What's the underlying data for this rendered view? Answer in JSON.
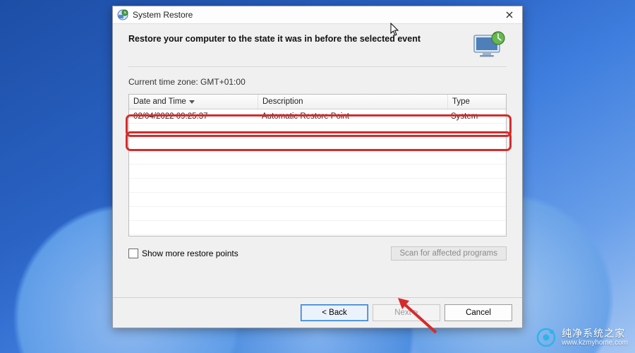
{
  "window": {
    "title": "System Restore",
    "heading": "Restore your computer to the state it was in before the selected event"
  },
  "timezone_label": "Current time zone: GMT+01:00",
  "columns": {
    "datetime": "Date and Time",
    "description": "Description",
    "type": "Type"
  },
  "rows": [
    {
      "datetime": "02/04/2022 09:25:37",
      "description": "Automatic Restore Point",
      "type": "System"
    }
  ],
  "checkbox_label": "Show more restore points",
  "buttons": {
    "scan": "Scan for affected programs",
    "back": "< Back",
    "next": "Next >",
    "cancel": "Cancel"
  },
  "watermark": {
    "cn": "纯净系统之家",
    "url": "www.kzmyhome.com"
  },
  "colors": {
    "highlight": "#d62b2b",
    "accent": "#2a7bd4"
  }
}
